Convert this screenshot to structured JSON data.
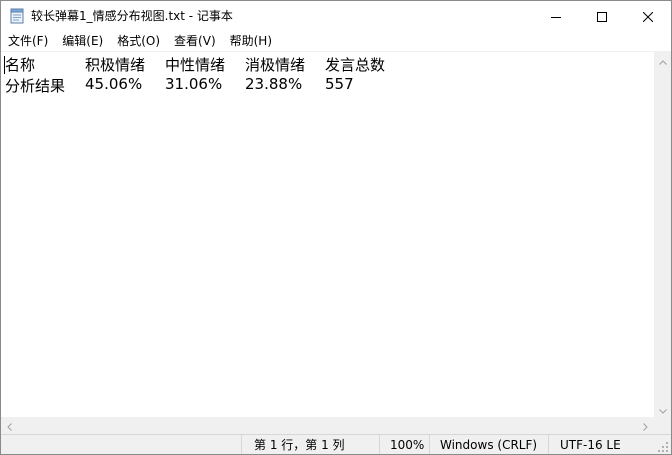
{
  "window": {
    "title": "较长弹幕1_情感分布视图.txt - 记事本"
  },
  "menu": {
    "items": [
      "文件(F)",
      "编辑(E)",
      "格式(O)",
      "查看(V)",
      "帮助(H)"
    ]
  },
  "document": {
    "lines": [
      [
        "名称",
        "积极情绪",
        "中性情绪",
        "消极情绪",
        "发言总数"
      ],
      [
        "分析结果",
        "45.06%",
        "31.06%",
        "23.88%",
        "557"
      ]
    ]
  },
  "statusbar": {
    "position": "第 1 行，第 1 列",
    "zoom": "100%",
    "line_ending": "Windows (CRLF)",
    "encoding": "UTF-16 LE"
  },
  "icons": {
    "app": "notepad-icon",
    "minimize": "minimize-icon",
    "maximize": "maximize-icon",
    "close": "close-icon"
  }
}
